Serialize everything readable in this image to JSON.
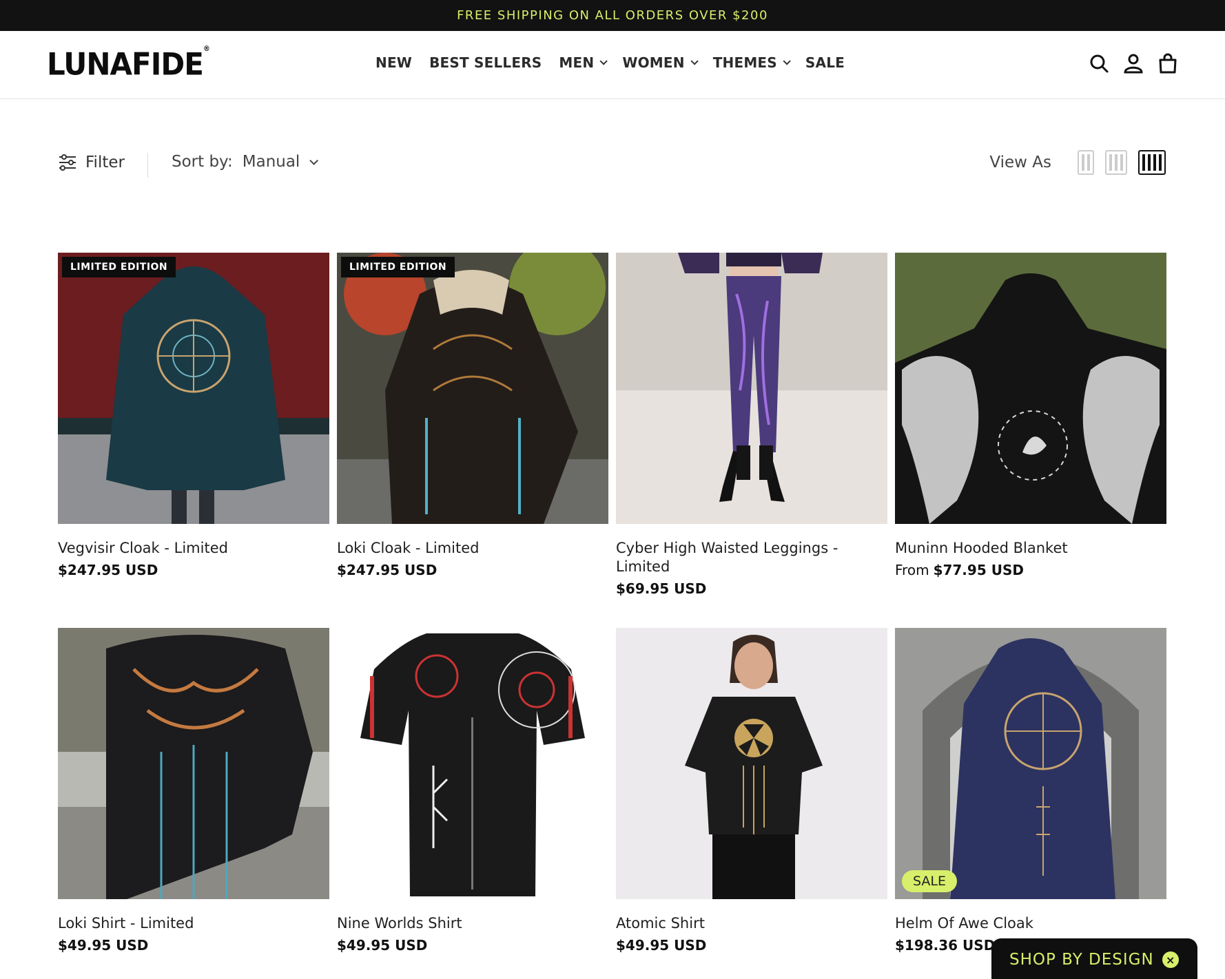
{
  "announcement": {
    "text": "FREE SHIPPING ON ALL ORDERS OVER $200"
  },
  "header": {
    "logo": "LUNAFIDE",
    "nav": [
      {
        "label": "NEW",
        "dropdown": false
      },
      {
        "label": "BEST SELLERS",
        "dropdown": false
      },
      {
        "label": "MEN",
        "dropdown": true
      },
      {
        "label": "WOMEN",
        "dropdown": true
      },
      {
        "label": "THEMES",
        "dropdown": true
      },
      {
        "label": "SALE",
        "dropdown": false
      }
    ],
    "icons": [
      "search-icon",
      "account-icon",
      "cart-icon"
    ]
  },
  "toolbar": {
    "filter_label": "Filter",
    "sort_label": "Sort by:",
    "sort_value": "Manual",
    "view_as_label": "View As",
    "view_options": [
      "2 columns",
      "3 columns",
      "4 columns"
    ],
    "view_selected": "4 columns"
  },
  "products": [
    {
      "title": "Vegvisir Cloak - Limited",
      "price": "$247.95 USD",
      "badge": "LIMITED EDITION"
    },
    {
      "title": "Loki Cloak - Limited",
      "price": "$247.95 USD",
      "badge": "LIMITED EDITION"
    },
    {
      "title": "Cyber High Waisted Leggings - Limited",
      "price": "$69.95 USD"
    },
    {
      "title": "Muninn Hooded Blanket",
      "price_prefix": "From",
      "price": "$77.95 USD"
    },
    {
      "title": "Loki Shirt - Limited",
      "price": "$49.95 USD"
    },
    {
      "title": "Nine Worlds Shirt",
      "price": "$49.95 USD"
    },
    {
      "title": "Atomic Shirt",
      "price": "$49.95 USD"
    },
    {
      "title": "Helm Of Awe Cloak",
      "price": "$198.36 USD",
      "sale_badge": "SALE"
    }
  ],
  "floating": {
    "label": "SHOP BY DESIGN",
    "close": "×"
  },
  "colors": {
    "accent": "#d7ef6a",
    "dark": "#121212"
  }
}
